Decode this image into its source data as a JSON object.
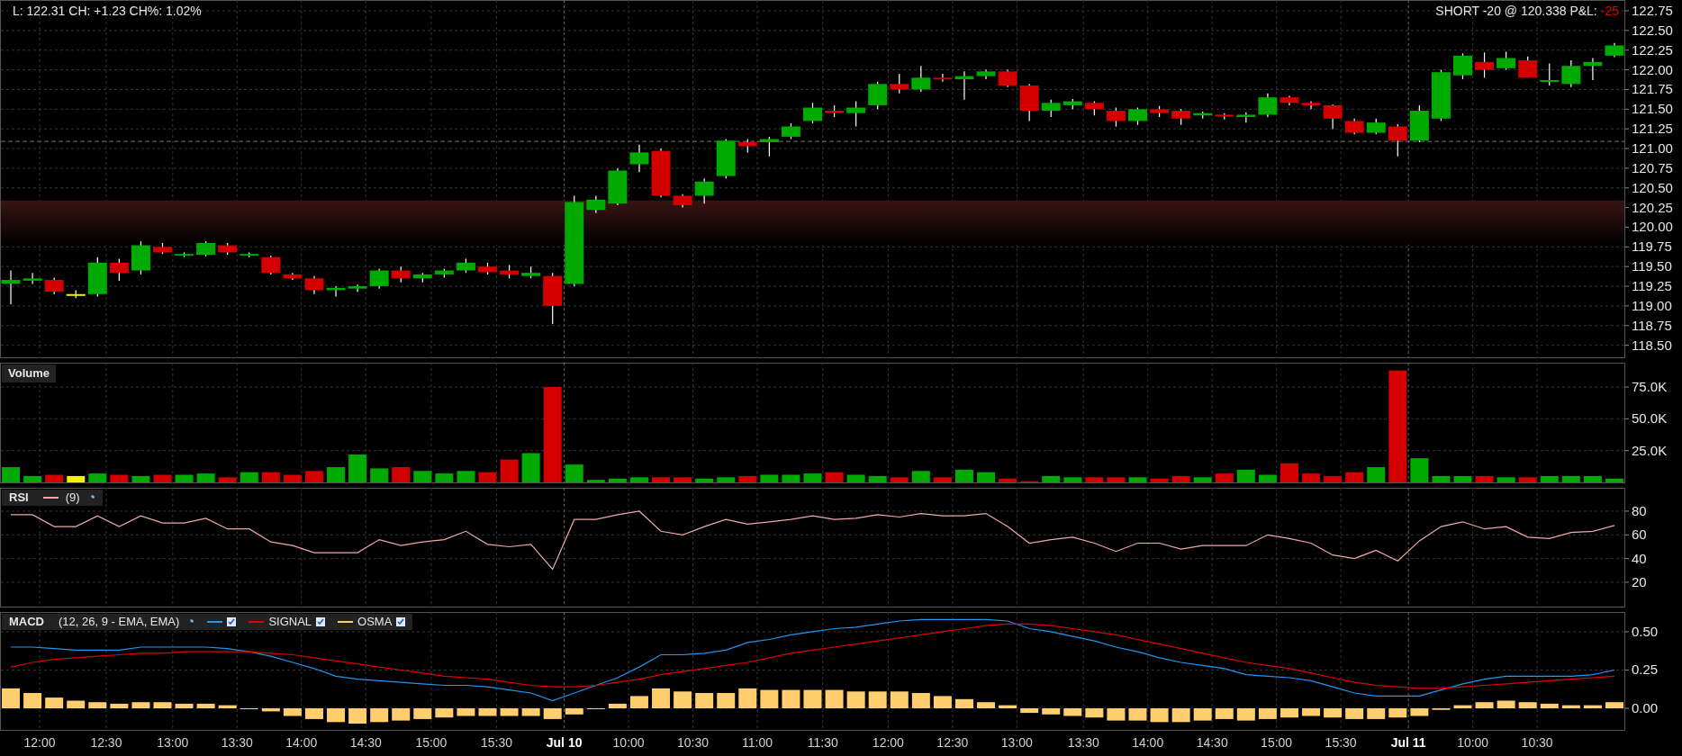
{
  "header": {
    "stats": "L: 122.31 CH: +1.23 CH%: 1.02%",
    "position": "SHORT -20 @ 120.338 P&L:",
    "pnl": "-25"
  },
  "price_pane": {
    "axis_labels": [
      "122.75",
      "122.50",
      "122.25",
      "122.00",
      "121.75",
      "121.50",
      "121.25",
      "121.00",
      "120.75",
      "120.50",
      "120.25",
      "120.00",
      "119.75",
      "119.50",
      "119.25",
      "119.00",
      "118.75",
      "118.50"
    ]
  },
  "volume_pane": {
    "chart_data": {
      "type": "bar",
      "ylim": [
        0,
        94.1
      ],
      "grid": true,
      "series": [
        {
          "name": "Volume",
          "values": [
            12,
            5,
            6,
            5,
            7,
            6,
            5,
            6,
            6,
            7,
            4,
            8,
            8,
            6,
            9,
            12,
            22,
            11,
            12,
            9,
            7,
            9,
            8,
            18,
            23,
            75,
            14,
            2,
            3,
            4,
            4,
            4,
            3,
            4,
            5,
            6,
            6,
            7,
            8,
            6,
            5,
            4,
            9,
            4,
            10,
            8,
            3,
            1,
            5,
            4,
            4,
            4,
            4,
            3,
            5,
            4,
            7,
            10,
            6,
            15,
            7,
            5,
            8,
            12,
            88,
            19,
            5,
            5,
            5,
            4,
            4,
            5,
            5,
            5,
            3
          ]
        }
      ],
      "yticks": [
        {
          "value": 25,
          "label": "25.0K"
        },
        {
          "value": 50,
          "label": "50.0K"
        },
        {
          "value": 75,
          "label": "75.0K"
        }
      ]
    }
  },
  "rsi_pane": {
    "params": "(9)",
    "chart_data": {
      "type": "line",
      "ylim": [
        -0.5,
        99.7
      ],
      "grid": true,
      "series": [
        {
          "name": "RSI",
          "color": "#f0a8a8",
          "values": [
            77,
            77,
            67,
            67,
            76,
            67,
            76,
            70,
            70,
            74,
            65,
            65,
            54,
            51,
            45,
            45,
            45,
            56,
            51,
            54,
            56,
            63,
            52,
            50,
            52,
            31,
            73,
            73,
            77,
            80,
            63,
            60,
            67,
            73,
            69,
            71,
            73,
            76,
            73,
            74,
            77,
            75,
            78,
            76,
            76,
            78,
            67,
            53,
            56,
            58,
            53,
            46,
            53,
            53,
            48,
            51,
            51,
            51,
            60,
            57,
            53,
            43,
            40,
            47,
            38,
            55,
            67,
            71,
            65,
            67,
            58,
            57,
            62,
            63,
            68
          ]
        }
      ],
      "yticks": [
        20,
        40,
        60,
        80
      ]
    }
  },
  "macd_pane": {
    "params": "(12, 26, 9 - EMA, EMA)",
    "legend": [
      {
        "checked": true
      },
      {
        "checked": true
      },
      {
        "checked": true
      }
    ],
    "chart_data": {
      "type": "line",
      "ylim": [
        -0.141,
        0.629
      ],
      "grid": true,
      "series": [
        {
          "name": "MACD",
          "color": "#2196f3",
          "values": [
            0.4,
            0.4,
            0.39,
            0.38,
            0.38,
            0.38,
            0.4,
            0.4,
            0.4,
            0.4,
            0.39,
            0.37,
            0.34,
            0.3,
            0.26,
            0.21,
            0.19,
            0.18,
            0.17,
            0.16,
            0.15,
            0.15,
            0.14,
            0.12,
            0.1,
            0.05,
            0.1,
            0.15,
            0.2,
            0.27,
            0.35,
            0.35,
            0.36,
            0.38,
            0.43,
            0.45,
            0.48,
            0.5,
            0.52,
            0.53,
            0.55,
            0.57,
            0.58,
            0.58,
            0.58,
            0.58,
            0.57,
            0.52,
            0.5,
            0.47,
            0.44,
            0.4,
            0.37,
            0.33,
            0.3,
            0.28,
            0.26,
            0.22,
            0.21,
            0.2,
            0.18,
            0.14,
            0.1,
            0.08,
            0.08,
            0.08,
            0.12,
            0.16,
            0.19,
            0.21,
            0.21,
            0.21,
            0.21,
            0.22,
            0.25
          ]
        },
        {
          "name": "SIGNAL",
          "color": "#e00000",
          "values": [
            0.27,
            0.3,
            0.32,
            0.33,
            0.34,
            0.35,
            0.36,
            0.36,
            0.37,
            0.37,
            0.37,
            0.37,
            0.36,
            0.35,
            0.33,
            0.31,
            0.29,
            0.27,
            0.25,
            0.23,
            0.21,
            0.2,
            0.19,
            0.17,
            0.15,
            0.14,
            0.14,
            0.15,
            0.17,
            0.19,
            0.22,
            0.24,
            0.26,
            0.28,
            0.3,
            0.33,
            0.36,
            0.38,
            0.4,
            0.42,
            0.44,
            0.46,
            0.48,
            0.5,
            0.52,
            0.54,
            0.55,
            0.55,
            0.54,
            0.52,
            0.5,
            0.48,
            0.45,
            0.42,
            0.39,
            0.36,
            0.33,
            0.3,
            0.28,
            0.26,
            0.23,
            0.2,
            0.17,
            0.15,
            0.14,
            0.13,
            0.13,
            0.14,
            0.15,
            0.16,
            0.17,
            0.18,
            0.19,
            0.2,
            0.21
          ]
        },
        {
          "name": "OSMA",
          "type": "bar",
          "color": "#ffcf6e",
          "values": [
            0.13,
            0.1,
            0.07,
            0.05,
            0.04,
            0.03,
            0.04,
            0.04,
            0.03,
            0.03,
            0.02,
            0.0,
            -0.02,
            -0.05,
            -0.07,
            -0.09,
            -0.1,
            -0.09,
            -0.08,
            -0.07,
            -0.06,
            -0.05,
            -0.05,
            -0.05,
            -0.05,
            -0.07,
            -0.04,
            0.0,
            0.03,
            0.08,
            0.13,
            0.11,
            0.1,
            0.1,
            0.13,
            0.12,
            0.12,
            0.12,
            0.12,
            0.11,
            0.11,
            0.11,
            0.1,
            0.08,
            0.06,
            0.04,
            0.02,
            -0.03,
            -0.04,
            -0.05,
            -0.06,
            -0.08,
            -0.08,
            -0.09,
            -0.09,
            -0.08,
            -0.07,
            -0.08,
            -0.07,
            -0.06,
            -0.05,
            -0.06,
            -0.07,
            -0.07,
            -0.06,
            -0.05,
            -0.01,
            0.02,
            0.04,
            0.05,
            0.04,
            0.03,
            0.02,
            0.02,
            0.04
          ]
        }
      ],
      "yticks": [
        {
          "value": 0,
          "label": "0.00"
        },
        {
          "value": 0.25,
          "label": "0.25"
        },
        {
          "value": 0.5,
          "label": "0.50"
        }
      ]
    }
  },
  "x_axis": {
    "ticks": [
      {
        "label": "12:00",
        "kind": "time"
      },
      {
        "label": "12:30",
        "kind": "time"
      },
      {
        "label": "13:00",
        "kind": "time"
      },
      {
        "label": "13:30",
        "kind": "time"
      },
      {
        "label": "14:00",
        "kind": "time"
      },
      {
        "label": "14:30",
        "kind": "time"
      },
      {
        "label": "15:00",
        "kind": "time"
      },
      {
        "label": "15:30",
        "kind": "time"
      },
      {
        "label": "Jul 10",
        "kind": "date"
      },
      {
        "label": "10:00",
        "kind": "time"
      },
      {
        "label": "10:30",
        "kind": "time"
      },
      {
        "label": "11:00",
        "kind": "time"
      },
      {
        "label": "11:30",
        "kind": "time"
      },
      {
        "label": "12:00",
        "kind": "time"
      },
      {
        "label": "12:30",
        "kind": "time"
      },
      {
        "label": "13:00",
        "kind": "time"
      },
      {
        "label": "13:30",
        "kind": "time"
      },
      {
        "label": "14:00",
        "kind": "time"
      },
      {
        "label": "14:30",
        "kind": "time"
      },
      {
        "label": "15:00",
        "kind": "time"
      },
      {
        "label": "15:30",
        "kind": "time"
      },
      {
        "label": "Jul 11",
        "kind": "date"
      },
      {
        "label": "10:00",
        "kind": "time"
      },
      {
        "label": "10:30",
        "kind": "time"
      }
    ]
  }
}
